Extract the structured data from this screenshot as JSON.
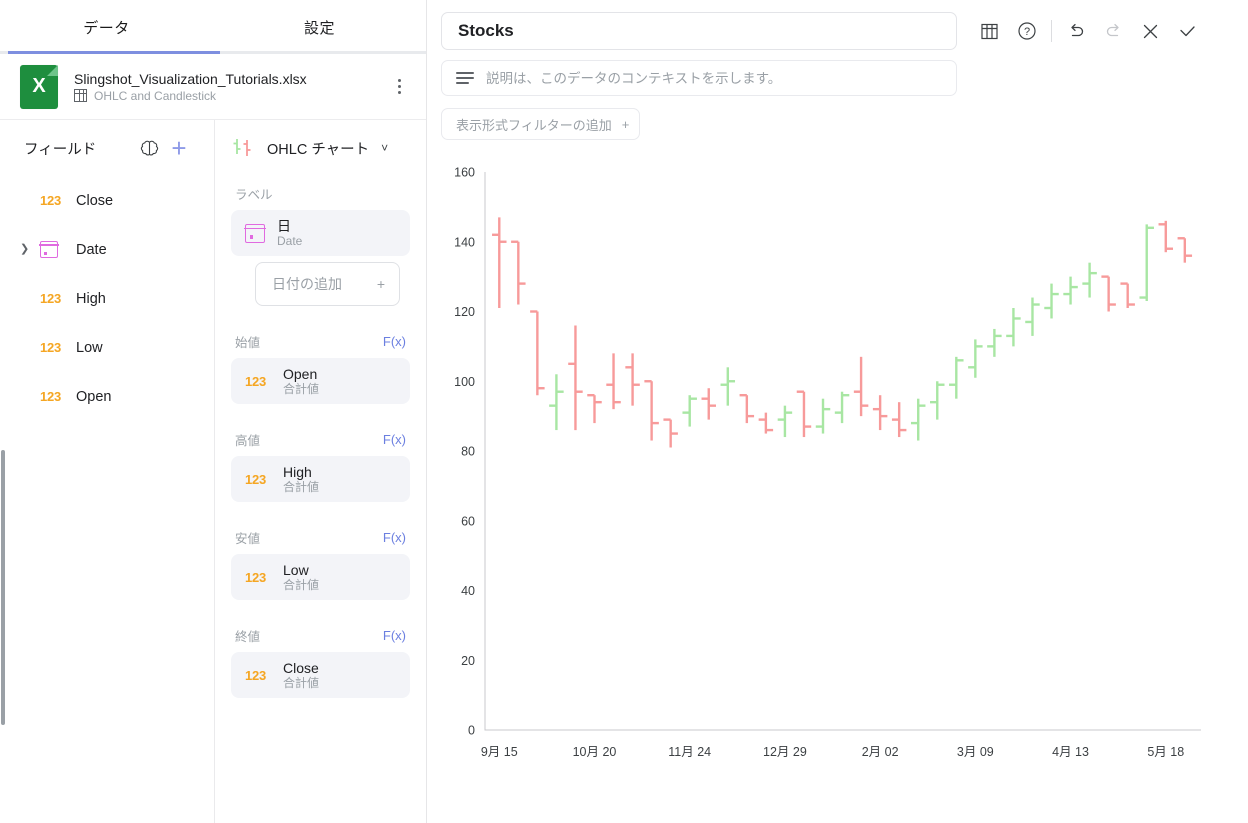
{
  "tabs": [
    {
      "label": "データ",
      "active": true
    },
    {
      "label": "設定",
      "active": false
    }
  ],
  "file": {
    "name": "Slingshot_Visualization_Tutorials.xlsx",
    "sheet": "OHLC and Candlestick",
    "icon_letter": "X"
  },
  "fields_panel": {
    "title": "フィールド",
    "items": [
      {
        "label": "Close",
        "type": "123",
        "expandable": false
      },
      {
        "label": "Date",
        "type": "date",
        "expandable": true
      },
      {
        "label": "High",
        "type": "123",
        "expandable": false
      },
      {
        "label": "Low",
        "type": "123",
        "expandable": false
      },
      {
        "label": "Open",
        "type": "123",
        "expandable": false
      }
    ]
  },
  "config_panel": {
    "chart_type": "OHLC チャート",
    "sections": [
      {
        "label": "ラベル",
        "fx": null,
        "chip": {
          "main": "日",
          "sub": "Date",
          "type": "date"
        },
        "dropzone": "日付の追加"
      },
      {
        "label": "始値",
        "fx": "F(x)",
        "chip": {
          "main": "Open",
          "sub": "合計値",
          "type": "123"
        },
        "dropzone": null
      },
      {
        "label": "高値",
        "fx": "F(x)",
        "chip": {
          "main": "High",
          "sub": "合計値",
          "type": "123"
        },
        "dropzone": null
      },
      {
        "label": "安値",
        "fx": "F(x)",
        "chip": {
          "main": "Low",
          "sub": "合計値",
          "type": "123"
        },
        "dropzone": null
      },
      {
        "label": "終値",
        "fx": "F(x)",
        "chip": {
          "main": "Close",
          "sub": "合計値",
          "type": "123"
        },
        "dropzone": null
      }
    ]
  },
  "header": {
    "title_value": "Stocks",
    "title_placeholder": "タイトル",
    "description_value": "",
    "description_placeholder": "説明は、このデータのコンテキストを示します。",
    "filter_button": "表示形式フィルターの追加",
    "toolbar": [
      {
        "name": "table-view-icon",
        "label": "テーブル表示"
      },
      {
        "name": "help-icon",
        "label": "ヘルプ"
      },
      {
        "name": "undo-icon",
        "label": "元に戻す"
      },
      {
        "name": "redo-icon",
        "label": "やり直す"
      },
      {
        "name": "close-icon",
        "label": "閉じる"
      },
      {
        "name": "confirm-icon",
        "label": "確定"
      }
    ]
  },
  "colors": {
    "up": "#a8e6a3",
    "down": "#f79a9a",
    "accent": "#7e8fe0",
    "number_badge": "#f5a623",
    "date_badge": "#e06ae0",
    "axis": "#c8c9cc"
  },
  "chart_data": {
    "type": "ohlc",
    "title": "Stocks",
    "xlabel": "",
    "ylabel": "",
    "ylim": [
      0,
      160
    ],
    "yticks": [
      0,
      20,
      40,
      60,
      80,
      100,
      120,
      140,
      160
    ],
    "grid": false,
    "legend": null,
    "xticks": [
      "9月 15",
      "10月 20",
      "11月 24",
      "12月 29",
      "2月 02",
      "3月 09",
      "4月 13",
      "5月 18"
    ],
    "xtick_indices": [
      0,
      5,
      10,
      15,
      20,
      25,
      30,
      35
    ],
    "series_name": "Stocks",
    "fields": [
      "open",
      "high",
      "low",
      "close"
    ],
    "bars": [
      {
        "open": 142,
        "high": 147,
        "low": 121,
        "close": 140
      },
      {
        "open": 140,
        "high": 140,
        "low": 122,
        "close": 128
      },
      {
        "open": 120,
        "high": 120,
        "low": 96,
        "close": 98
      },
      {
        "open": 93,
        "high": 102,
        "low": 86,
        "close": 97
      },
      {
        "open": 105,
        "high": 116,
        "low": 86,
        "close": 97
      },
      {
        "open": 96,
        "high": 96,
        "low": 88,
        "close": 94
      },
      {
        "open": 99,
        "high": 108,
        "low": 92,
        "close": 94
      },
      {
        "open": 104,
        "high": 108,
        "low": 93,
        "close": 99
      },
      {
        "open": 100,
        "high": 100,
        "low": 83,
        "close": 88
      },
      {
        "open": 89,
        "high": 89,
        "low": 81,
        "close": 85
      },
      {
        "open": 91,
        "high": 96,
        "low": 87,
        "close": 95
      },
      {
        "open": 95,
        "high": 98,
        "low": 89,
        "close": 93
      },
      {
        "open": 99,
        "high": 104,
        "low": 93,
        "close": 100
      },
      {
        "open": 96,
        "high": 96,
        "low": 88,
        "close": 90
      },
      {
        "open": 89,
        "high": 91,
        "low": 85,
        "close": 86
      },
      {
        "open": 89,
        "high": 93,
        "low": 84,
        "close": 91
      },
      {
        "open": 97,
        "high": 97,
        "low": 84,
        "close": 87
      },
      {
        "open": 87,
        "high": 95,
        "low": 85,
        "close": 92
      },
      {
        "open": 91,
        "high": 97,
        "low": 88,
        "close": 96
      },
      {
        "open": 97,
        "high": 107,
        "low": 90,
        "close": 93
      },
      {
        "open": 92,
        "high": 96,
        "low": 86,
        "close": 90
      },
      {
        "open": 89,
        "high": 94,
        "low": 84,
        "close": 86
      },
      {
        "open": 88,
        "high": 95,
        "low": 83,
        "close": 93
      },
      {
        "open": 94,
        "high": 100,
        "low": 89,
        "close": 99
      },
      {
        "open": 99,
        "high": 107,
        "low": 95,
        "close": 106
      },
      {
        "open": 104,
        "high": 112,
        "low": 101,
        "close": 110
      },
      {
        "open": 110,
        "high": 115,
        "low": 107,
        "close": 113
      },
      {
        "open": 113,
        "high": 121,
        "low": 110,
        "close": 118
      },
      {
        "open": 117,
        "high": 124,
        "low": 113,
        "close": 122
      },
      {
        "open": 121,
        "high": 128,
        "low": 118,
        "close": 125
      },
      {
        "open": 125,
        "high": 130,
        "low": 122,
        "close": 127
      },
      {
        "open": 128,
        "high": 134,
        "low": 124,
        "close": 131
      },
      {
        "open": 130,
        "high": 130,
        "low": 120,
        "close": 122
      },
      {
        "open": 128,
        "high": 128,
        "low": 121,
        "close": 122
      },
      {
        "open": 124,
        "high": 145,
        "low": 123,
        "close": 144
      },
      {
        "open": 145,
        "high": 146,
        "low": 137,
        "close": 138
      },
      {
        "open": 141,
        "high": 141,
        "low": 134,
        "close": 136
      }
    ]
  }
}
